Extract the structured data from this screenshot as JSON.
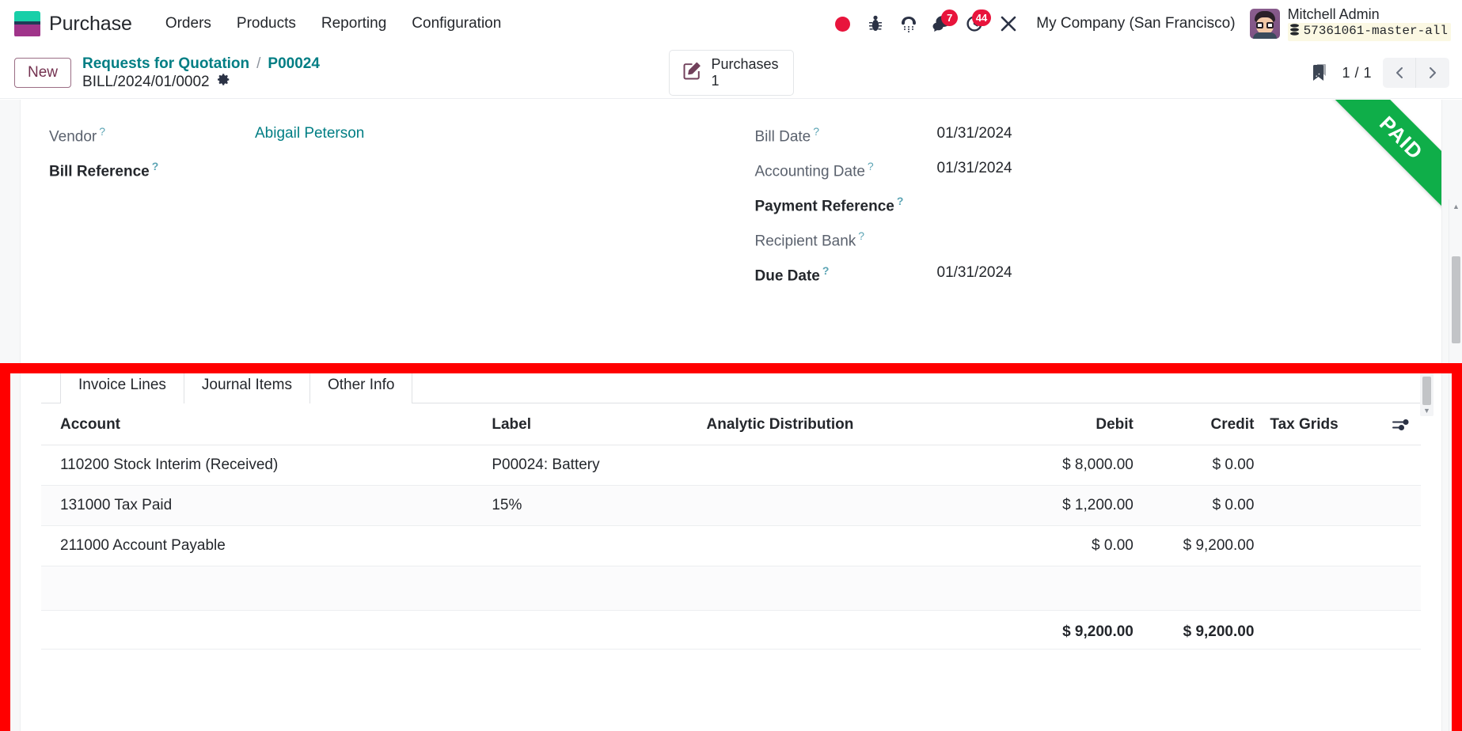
{
  "navbar": {
    "brand": "Purchase",
    "menu": [
      "Orders",
      "Products",
      "Reporting",
      "Configuration"
    ],
    "icons": [
      {
        "name": "recording-indicator-icon",
        "badge": null
      },
      {
        "name": "bug-icon",
        "badge": null
      },
      {
        "name": "phone-icon",
        "badge": null
      },
      {
        "name": "messages-icon",
        "badge": "7"
      },
      {
        "name": "activities-clock-icon",
        "badge": "44"
      },
      {
        "name": "tools-icon",
        "badge": null
      }
    ],
    "messages_badge": "7",
    "activities_badge": "44",
    "company": "My Company (San Francisco)",
    "user_name": "Mitchell Admin",
    "database": "57361061-master-all"
  },
  "control_panel": {
    "new_button": "New",
    "breadcrumb_parent": "Requests for Quotation",
    "breadcrumb_separator": "/",
    "breadcrumb_current": "P00024",
    "record_name": "BILL/2024/01/0002",
    "gear_icon": "gear-icon",
    "smart_button": {
      "icon": "edit-document-icon",
      "label": "Purchases",
      "value": "1"
    },
    "bookmark_icon": "bookmark-icon",
    "pager": "1 / 1",
    "prev_label": "‹",
    "next_label": "›"
  },
  "ribbon": {
    "text": "PAID",
    "color": "#0fae49"
  },
  "form": {
    "left": [
      {
        "label": "Vendor",
        "help": "?",
        "value": "Abigail Peterson",
        "required": false,
        "is_link": true
      },
      {
        "label": "Bill Reference",
        "help": "?",
        "value": "",
        "required": true,
        "is_link": false
      }
    ],
    "right": [
      {
        "label": "Bill Date",
        "help": "?",
        "value": "01/31/2024",
        "required": false
      },
      {
        "label": "Accounting Date",
        "help": "?",
        "value": "01/31/2024",
        "required": false
      },
      {
        "label": "Payment Reference",
        "help": "?",
        "value": "",
        "required": true
      },
      {
        "label": "Recipient Bank",
        "help": "?",
        "value": "",
        "required": false
      },
      {
        "label": "Due Date",
        "help": "?",
        "value": "01/31/2024",
        "required": true
      }
    ]
  },
  "notebook": {
    "tabs": [
      {
        "label": "Invoice Lines",
        "active": false
      },
      {
        "label": "Journal Items",
        "active": true
      },
      {
        "label": "Other Info",
        "active": false
      }
    ],
    "table": {
      "headers": [
        "Account",
        "Label",
        "Analytic Distribution",
        "Debit",
        "Credit",
        "Tax Grids"
      ],
      "optional_columns_icon": "sliders-icon",
      "rows": [
        {
          "account": "110200 Stock Interim (Received)",
          "label": "P00024: Battery",
          "analytic": "",
          "debit": "$ 8,000.00",
          "credit": "$ 0.00",
          "tax_grids": ""
        },
        {
          "account": "131000 Tax Paid",
          "label": "15%",
          "analytic": "",
          "debit": "$ 1,200.00",
          "credit": "$ 0.00",
          "tax_grids": ""
        },
        {
          "account": "211000 Account Payable",
          "label": "",
          "analytic": "",
          "debit": "$ 0.00",
          "credit": "$ 9,200.00",
          "tax_grids": ""
        }
      ],
      "totals": {
        "debit": "$ 9,200.00",
        "credit": "$ 9,200.00"
      }
    }
  },
  "annotation": {
    "color": "#ff0000"
  }
}
